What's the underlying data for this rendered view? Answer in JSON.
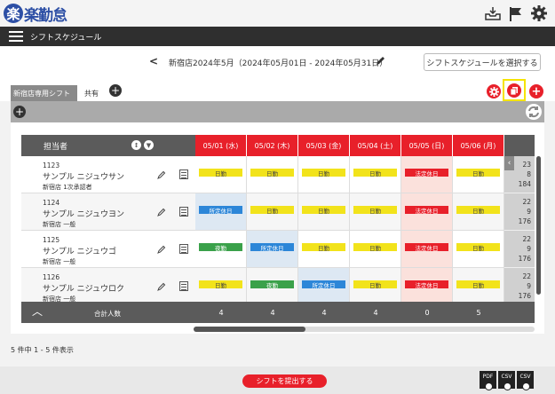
{
  "app": {
    "logo_badge": "楽",
    "logo_text": "楽勤怠"
  },
  "header_icons": [
    "inbox-icon",
    "flag-icon",
    "gear-icon"
  ],
  "nav": {
    "title": "シフトスケジュール"
  },
  "period": {
    "prev": "<",
    "label": "新宿店2024年5月（2024年05月01日 - 2024年05月31日）",
    "select_button": "シフトスケジュールを選択する"
  },
  "tabs": {
    "active": "新宿店専用シフト",
    "shared": "共有",
    "add": "+"
  },
  "grid": {
    "employee_header": "担当者",
    "dates": [
      "05/01 (水)",
      "05/02 (木)",
      "05/03 (金)",
      "05/04 (土)",
      "05/05 (日)",
      "05/06 (月)"
    ],
    "rows": [
      {
        "code": "1123",
        "name": "サンプル ニジュウサン",
        "dept": "新宿店 1次承認者",
        "shifts": [
          "日勤",
          "日勤",
          "日勤",
          "日勤",
          "法定休日",
          "日勤"
        ],
        "summary": [
          "23",
          "8",
          "184"
        ]
      },
      {
        "code": "1124",
        "name": "サンプル ニジュウヨン",
        "dept": "新宿店 一般",
        "shifts": [
          "所定休日",
          "日勤",
          "日勤",
          "日勤",
          "法定休日",
          "日勤"
        ],
        "summary": [
          "22",
          "9",
          "176"
        ]
      },
      {
        "code": "1125",
        "name": "サンプル ニジュウゴ",
        "dept": "新宿店 一般",
        "shifts": [
          "夜勤",
          "所定休日",
          "日勤",
          "日勤",
          "法定休日",
          "日勤"
        ],
        "summary": [
          "22",
          "9",
          "176"
        ]
      },
      {
        "code": "1126",
        "name": "サンプル ニジュウロク",
        "dept": "新宿店 一般",
        "shifts": [
          "日勤",
          "夜勤",
          "所定休日",
          "日勤",
          "法定休日",
          "日勤"
        ],
        "summary": [
          "22",
          "9",
          "176"
        ]
      }
    ],
    "footer_label": "合計人数",
    "totals": [
      "4",
      "4",
      "4",
      "4",
      "0",
      "5"
    ]
  },
  "pagination": {
    "text": "5 件中 1 - 5 件表示"
  },
  "bottom": {
    "submit": "シフトを提出する",
    "exports": [
      "PDF",
      "CSV",
      "CSV"
    ]
  },
  "colors": {
    "accent_red": "#e8202a",
    "work": "#f2e31b",
    "off": "#2c86d8",
    "night": "#3aa14a",
    "highlight": "#f5e400"
  }
}
